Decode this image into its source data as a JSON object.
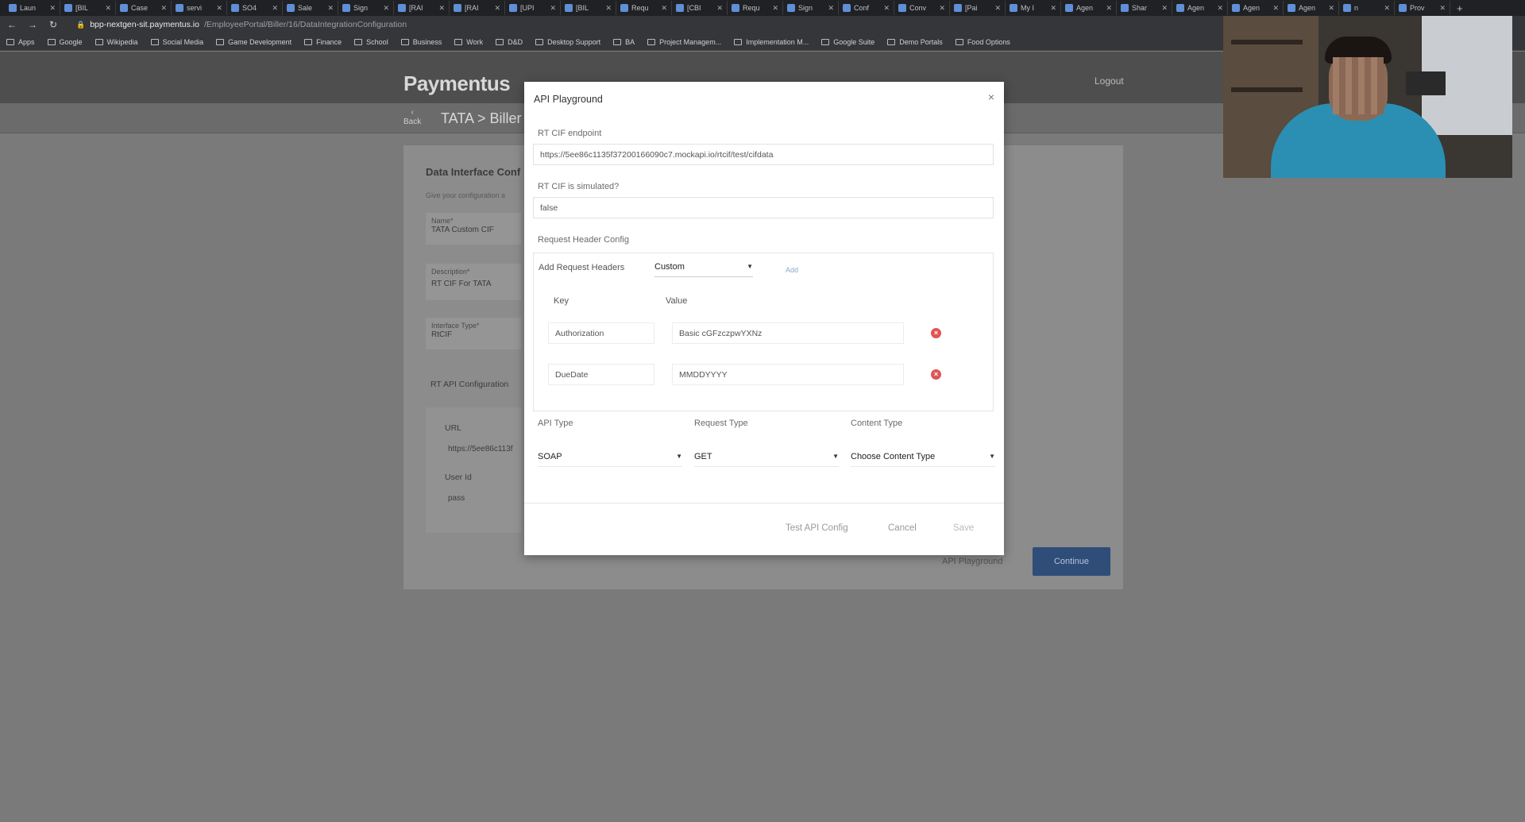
{
  "browser": {
    "tabs": [
      {
        "label": "Laun"
      },
      {
        "label": "[BIL"
      },
      {
        "label": "Case"
      },
      {
        "label": "servi"
      },
      {
        "label": "SO4"
      },
      {
        "label": "Sale"
      },
      {
        "label": "Sign"
      },
      {
        "label": "[RAI"
      },
      {
        "label": "[RAI"
      },
      {
        "label": "[UPI"
      },
      {
        "label": "[BIL"
      },
      {
        "label": "Requ"
      },
      {
        "label": "[CBI"
      },
      {
        "label": "Requ"
      },
      {
        "label": "Sign"
      },
      {
        "label": "Conf"
      },
      {
        "label": "Conv"
      },
      {
        "label": "[Pai"
      },
      {
        "label": "My I"
      },
      {
        "label": "Agen"
      },
      {
        "label": "Shar"
      },
      {
        "label": "Agen"
      },
      {
        "label": "Agen"
      },
      {
        "label": "Agen"
      },
      {
        "label": "n"
      },
      {
        "label": "Prov"
      }
    ],
    "url_host": "bpp-nextgen-sit.paymentus.io",
    "url_path": "/EmployeePortal/Biller/16/DataIntegrationConfiguration",
    "bookmarks": [
      "Apps",
      "Google",
      "Wikipedia",
      "Social Media",
      "Game Development",
      "Finance",
      "School",
      "Business",
      "Work",
      "D&D",
      "Desktop Support",
      "BA",
      "Project Managem...",
      "Implementation M...",
      "Google Suite",
      "Demo Portals",
      "Food Options"
    ]
  },
  "app": {
    "logo": "Paymentus",
    "logout": "Logout",
    "back": "Back",
    "breadcrumb": "TATA > Biller"
  },
  "background_form": {
    "title": "Data Interface Conf",
    "subtitle": "Give your configuration a",
    "name_label": "Name*",
    "name_value": "TATA Custom CIF",
    "description_label": "Description*",
    "description_value": "RT CIF For TATA",
    "interface_type_label": "Interface Type*",
    "interface_type_value": "RtCIF",
    "rt_api_config_label": "RT API Configuration",
    "url_label": "URL",
    "url_value": "https://5ee86c113f",
    "user_id_label": "User Id",
    "user_id_value": "pass",
    "api_playground_link": "API Playground",
    "continue_button": "Continue"
  },
  "modal": {
    "title": "API Playground",
    "close": "×",
    "rt_cif_endpoint_label": "RT CIF endpoint",
    "rt_cif_endpoint_value": "https://5ee86c1135f37200166090c7.mockapi.io/rtcif/test/cifdata",
    "rt_cif_simulated_label": "RT CIF is simulated?",
    "rt_cif_simulated_value": "false",
    "request_header_config_label": "Request Header Config",
    "add_request_headers_label": "Add Request Headers",
    "add_request_headers_value": "Custom",
    "add_link": "Add",
    "key_header": "Key",
    "value_header": "Value",
    "headers": [
      {
        "key": "Authorization",
        "value": "Basic cGFzczpwYXNz"
      },
      {
        "key": "DueDate",
        "value": "MMDDYYYY"
      }
    ],
    "api_type_label": "API Type",
    "api_type_value": "SOAP",
    "request_type_label": "Request Type",
    "request_type_value": "GET",
    "content_type_label": "Content Type",
    "content_type_value": "Choose Content Type",
    "test_button": "Test API Config",
    "cancel_button": "Cancel",
    "save_button": "Save"
  }
}
